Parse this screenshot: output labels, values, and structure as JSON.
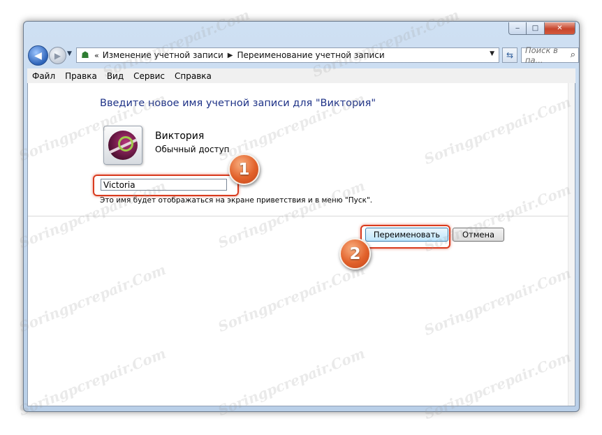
{
  "window": {
    "caption_buttons": {
      "minimize": "‒",
      "maximize": "□",
      "close": "✕"
    }
  },
  "nav": {
    "back_icon": "arrow-left-icon",
    "forward_icon": "arrow-right-icon",
    "breadcrumb": {
      "overflow": "«",
      "items": [
        "Изменение учетной записи",
        "Переименование учетной записи"
      ]
    },
    "search": {
      "placeholder": "Поиск в па..."
    }
  },
  "menubar": {
    "items": [
      "Файл",
      "Правка",
      "Вид",
      "Сервис",
      "Справка"
    ]
  },
  "content": {
    "heading": "Введите новое имя учетной записи для \"Виктория\"",
    "user": {
      "name": "Виктория",
      "role": "Обычный доступ"
    },
    "name_input": {
      "value": "Victoria"
    },
    "hint": "Это имя будет отображаться на экране приветствия и в меню \"Пуск\".",
    "buttons": {
      "rename": "Переименовать",
      "cancel": "Отмена"
    }
  },
  "annotations": {
    "badge_1": "1",
    "badge_2": "2",
    "highlight_color": "#d93b1e"
  },
  "watermark": "Soringpcrepair.Com"
}
